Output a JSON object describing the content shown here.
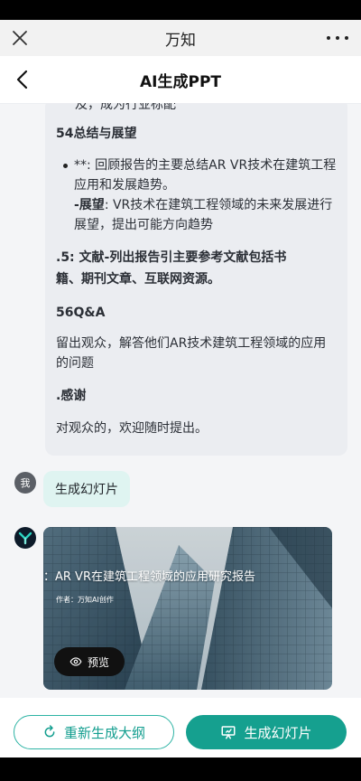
{
  "window": {
    "title": "万知",
    "close_icon": "close-icon",
    "more_icon": "more-icon"
  },
  "header": {
    "title": "AI生成PPT",
    "back_icon": "chevron-left-icon"
  },
  "ai_message": {
    "partial_line": "及，成为行业标配",
    "section_54_title": "54总结与展望",
    "bullet_line1": "**: 回顾报告的主要总结AR VR技术在建筑工程",
    "bullet_line2": "应用和发展趋势。",
    "outlook_label": "-展望",
    "outlook_line1": ": VR技术在建筑工程领域的未来发展进行",
    "outlook_line2": "展望，提出可能方向趋势",
    "ref_line1": ".5:  文献-列出报告引主要参考文献包括书",
    "ref_line2": "籍、期刊文章、互联网资源。",
    "qa_title": "56Q&A",
    "qa_line1": "留出观众，解答他们AR技术建筑工程领域的应用",
    "qa_line2": "的问题",
    "thanks_title": ".感谢",
    "thanks_line": "对观众的，欢迎随时提出。"
  },
  "user_message": {
    "avatar_label": "我",
    "text": "生成幻灯片"
  },
  "slide_preview": {
    "title": "：AR VR在建筑工程领域的应用研究报告",
    "author": "作者：万知AI创作",
    "preview_label": "预览",
    "eye_icon": "eye-icon",
    "ai_avatar_icon": "wanzhi-logo-icon"
  },
  "actions": {
    "regenerate_label": "重新生成大纲",
    "regenerate_icon": "refresh-icon",
    "generate_label": "生成幻灯片",
    "generate_icon": "presentation-icon",
    "accent_color": "#15a08f"
  }
}
